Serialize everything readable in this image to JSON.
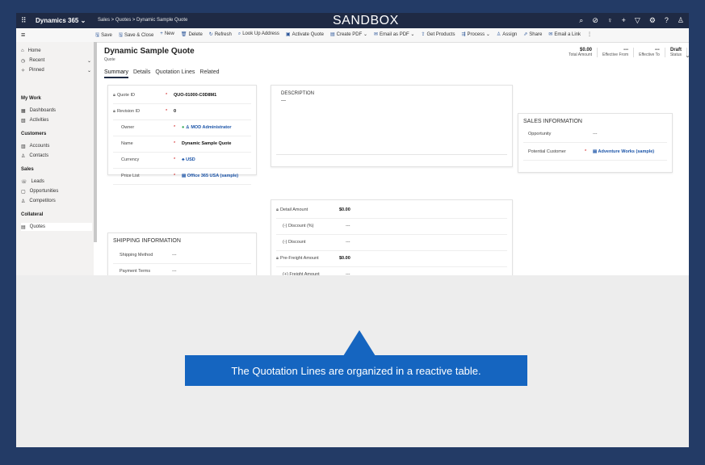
{
  "topbar": {
    "brand": "Dynamics 365",
    "brand_chevron": "⌄",
    "breadcrumb": "Sales  >  Quotes  >  Dynamic Sample Quote",
    "environment": "SANDBOX",
    "icons": [
      "search-icon",
      "target-icon",
      "lightbulb-icon",
      "plus-icon",
      "filter-icon",
      "gear-icon",
      "help-icon",
      "user-icon"
    ]
  },
  "commands": [
    {
      "icon": "🖫",
      "label": "Save"
    },
    {
      "icon": "🖫",
      "label": "Save & Close"
    },
    {
      "icon": "+",
      "label": "New"
    },
    {
      "icon": "🗑",
      "label": "Delete"
    },
    {
      "icon": "↻",
      "label": "Refresh"
    },
    {
      "icon": "⌕",
      "label": "Look Up Address"
    },
    {
      "icon": "▣",
      "label": "Activate Quote"
    },
    {
      "icon": "▤",
      "label": "Create PDF  ⌄"
    },
    {
      "icon": "✉",
      "label": "Email as PDF  ⌄"
    },
    {
      "icon": "⇪",
      "label": "Get Products"
    },
    {
      "icon": "⇶",
      "label": "Process  ⌄"
    },
    {
      "icon": "♙",
      "label": "Assign"
    },
    {
      "icon": "⇗",
      "label": "Share"
    },
    {
      "icon": "✉",
      "label": "Email a Link"
    },
    {
      "icon": "",
      "label": "⋮"
    }
  ],
  "sidebar": {
    "top": [
      {
        "icon": "⌂",
        "label": "Home"
      },
      {
        "icon": "◷",
        "label": "Recent"
      },
      {
        "icon": "✧",
        "label": "Pinned"
      }
    ],
    "groups": [
      {
        "title": "My Work",
        "items": [
          {
            "icon": "▦",
            "label": "Dashboards"
          },
          {
            "icon": "▧",
            "label": "Activities"
          }
        ]
      },
      {
        "title": "Customers",
        "items": [
          {
            "icon": "▥",
            "label": "Accounts"
          },
          {
            "icon": "♙",
            "label": "Contacts"
          }
        ]
      },
      {
        "title": "Sales",
        "items": [
          {
            "icon": "☏",
            "label": "Leads"
          },
          {
            "icon": "▢",
            "label": "Opportunities"
          },
          {
            "icon": "♙",
            "label": "Competitors"
          }
        ]
      },
      {
        "title": "Collateral",
        "items": [
          {
            "icon": "▤",
            "label": "Quotes"
          }
        ]
      }
    ]
  },
  "record": {
    "title": "Dynamic Sample Quote",
    "type": "Quote",
    "header_fields": [
      {
        "value": "$0.00",
        "label": "Total Amount"
      },
      {
        "value": "---",
        "label": "Effective From"
      },
      {
        "value": "---",
        "label": "Effective To"
      },
      {
        "value": "Draft",
        "label": "Status"
      }
    ],
    "tabs": [
      "Summary",
      "Details",
      "Quotation Lines",
      "Related"
    ]
  },
  "summary_fields": [
    {
      "label": "Quote ID",
      "value": "QUO-01000-C0D8M1",
      "locked": true,
      "style": "val"
    },
    {
      "label": "Revision ID",
      "value": "0",
      "locked": true,
      "style": "val"
    },
    {
      "label": "Owner",
      "value": "MOD Administrator",
      "locked": false,
      "style": "link"
    },
    {
      "label": "Name",
      "value": "Dynamic Sample Quote",
      "locked": false,
      "style": "val"
    },
    {
      "label": "Currency",
      "value": "USD",
      "locked": false,
      "style": "link"
    },
    {
      "label": "Price List",
      "value": "Office 365 USA (sample)",
      "locked": false,
      "style": "link"
    }
  ],
  "description": {
    "title": "DESCRIPTION",
    "value": "---"
  },
  "amounts": [
    {
      "label": "Detail Amount",
      "value": "$0.00",
      "locked": true
    },
    {
      "label": "(-) Discount (%)",
      "value": "---",
      "locked": false
    },
    {
      "label": "(-) Discount",
      "value": "---",
      "locked": false
    },
    {
      "label": "Pre-Freight Amount",
      "value": "$0.00",
      "locked": true
    },
    {
      "label": "(+) Freight Amount",
      "value": "---",
      "locked": false
    }
  ],
  "shipping": {
    "title": "SHIPPING INFORMATION",
    "fields": [
      {
        "label": "Shipping Method",
        "value": "---"
      },
      {
        "label": "Payment Terms",
        "value": "---"
      }
    ]
  },
  "sales_info": {
    "title": "SALES INFORMATION",
    "fields": [
      {
        "label": "Opportunity",
        "value": "---",
        "required": false
      },
      {
        "label": "Potential Customer",
        "value": "Adventure Works (sample)",
        "required": true
      }
    ]
  },
  "callout": "The Quotation Lines are organized in a reactive table."
}
